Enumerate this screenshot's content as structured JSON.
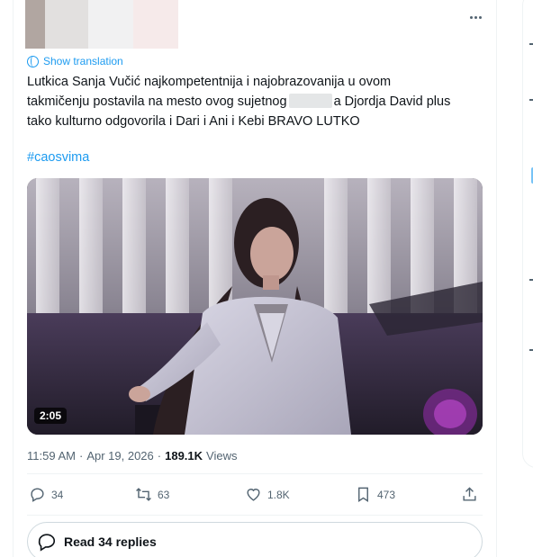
{
  "tweet": {
    "show_translation": "Show translation",
    "text_line1": "Lutkica Sanja Vučić najkompetentnija i najobrazovanija u ovom",
    "text_line2a": "takmičenju postavila na mesto ovog sujetnog",
    "text_line2b": "a Djordja David plus",
    "text_line3": "tako kulturno odgovorila i Dari i Ani i Kebi BRAVO LUTKO",
    "hashtag": "#caosvima",
    "video_duration": "2:05",
    "time": "11:59 AM",
    "date": "Apr 19, 2026",
    "separator": "·",
    "views_count": "189.1K",
    "views_label": "Views"
  },
  "actions": {
    "replies": "34",
    "reposts": "63",
    "likes": "1.8K",
    "bookmarks": "473"
  },
  "read_replies_label": "Read 34 replies",
  "icons": {
    "translate": "globe-icon",
    "more": "more-icon",
    "reply": "reply-icon",
    "repost": "repost-icon",
    "like": "heart-icon",
    "bookmark": "bookmark-icon",
    "share": "share-icon",
    "replies_bubble": "speech-bubble-icon"
  },
  "colors": {
    "accent": "#1d9bf0",
    "text": "#0f1419",
    "muted": "#536471",
    "border": "#eff3f4"
  }
}
